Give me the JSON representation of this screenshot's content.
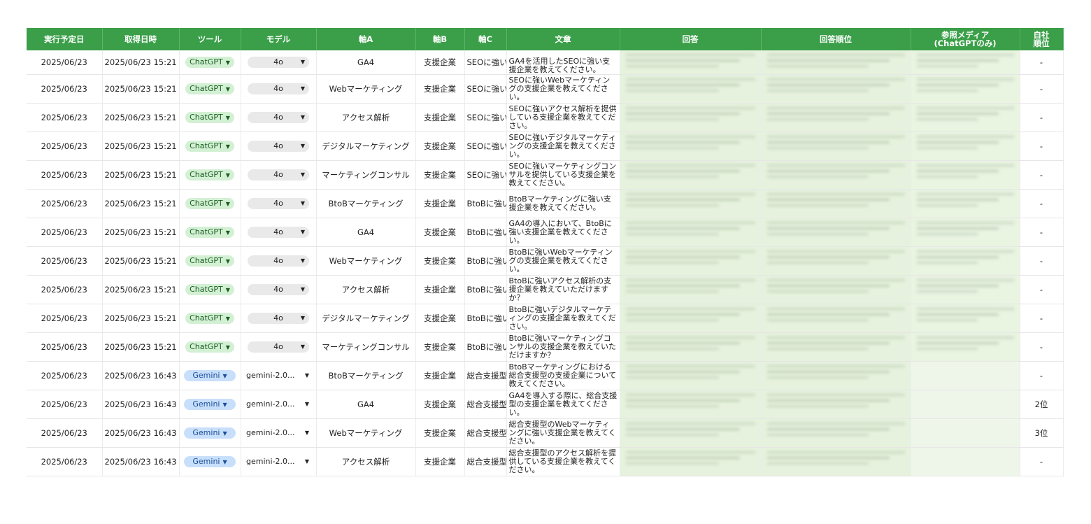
{
  "headers": [
    "実行予定日",
    "取得日時",
    "ツール",
    "モデル",
    "軸A",
    "軸B",
    "軸C",
    "文章",
    "回答",
    "回答順位",
    "参照メディア\n(ChatGPTのみ)",
    "自社\n順位"
  ],
  "rows": [
    {
      "date": "2025/06/23",
      "fetched": "2025/06/23 15:21",
      "tool": "ChatGPT",
      "model": "4o",
      "axisA": "GA4",
      "axisB": "支援企業",
      "axisC": "SEOに強い",
      "text": "GA4を活用したSEOに強い支援企業を教えてください。",
      "rank": "-"
    },
    {
      "date": "2025/06/23",
      "fetched": "2025/06/23 15:21",
      "tool": "ChatGPT",
      "model": "4o",
      "axisA": "Webマーケティング",
      "axisB": "支援企業",
      "axisC": "SEOに強い",
      "text": "SEOに強いWebマーケティングの支援企業を教えてください。",
      "rank": "-"
    },
    {
      "date": "2025/06/23",
      "fetched": "2025/06/23 15:21",
      "tool": "ChatGPT",
      "model": "4o",
      "axisA": "アクセス解析",
      "axisB": "支援企業",
      "axisC": "SEOに強い",
      "text": "SEOに強いアクセス解析を提供している支援企業を教えてください。",
      "rank": "-"
    },
    {
      "date": "2025/06/23",
      "fetched": "2025/06/23 15:21",
      "tool": "ChatGPT",
      "model": "4o",
      "axisA": "デジタルマーケティング",
      "axisB": "支援企業",
      "axisC": "SEOに強い",
      "text": "SEOに強いデジタルマーケティングの支援企業を教えてください。",
      "rank": "-"
    },
    {
      "date": "2025/06/23",
      "fetched": "2025/06/23 15:21",
      "tool": "ChatGPT",
      "model": "4o",
      "axisA": "マーケティングコンサル",
      "axisB": "支援企業",
      "axisC": "SEOに強い",
      "text": "SEOに強いマーケティングコンサルを提供している支援企業を教えてください。",
      "rank": "-"
    },
    {
      "date": "2025/06/23",
      "fetched": "2025/06/23 15:21",
      "tool": "ChatGPT",
      "model": "4o",
      "axisA": "BtoBマーケティング",
      "axisB": "支援企業",
      "axisC": "BtoBに強い",
      "text": "BtoBマーケティングに強い支援企業を教えてください。",
      "rank": "-"
    },
    {
      "date": "2025/06/23",
      "fetched": "2025/06/23 15:21",
      "tool": "ChatGPT",
      "model": "4o",
      "axisA": "GA4",
      "axisB": "支援企業",
      "axisC": "BtoBに強い",
      "text": "GA4の導入において、BtoBに強い支援企業を教えてください。",
      "rank": "-"
    },
    {
      "date": "2025/06/23",
      "fetched": "2025/06/23 15:21",
      "tool": "ChatGPT",
      "model": "4o",
      "axisA": "Webマーケティング",
      "axisB": "支援企業",
      "axisC": "BtoBに強い",
      "text": "BtoBに強いWebマーケティングの支援企業を教えてください。",
      "rank": "-"
    },
    {
      "date": "2025/06/23",
      "fetched": "2025/06/23 15:21",
      "tool": "ChatGPT",
      "model": "4o",
      "axisA": "アクセス解析",
      "axisB": "支援企業",
      "axisC": "BtoBに強い",
      "text": "BtoBに強いアクセス解析の支援企業を教えていただけますか？",
      "rank": "-"
    },
    {
      "date": "2025/06/23",
      "fetched": "2025/06/23 15:21",
      "tool": "ChatGPT",
      "model": "4o",
      "axisA": "デジタルマーケティング",
      "axisB": "支援企業",
      "axisC": "BtoBに強い",
      "text": "BtoBに強いデジタルマーケティングの支援企業を教えてください。",
      "rank": "-"
    },
    {
      "date": "2025/06/23",
      "fetched": "2025/06/23 15:21",
      "tool": "ChatGPT",
      "model": "4o",
      "axisA": "マーケティングコンサル",
      "axisB": "支援企業",
      "axisC": "BtoBに強い",
      "text": "BtoBに強いマーケティングコンサルの支援企業を教えていただけますか？",
      "rank": "-"
    },
    {
      "date": "2025/06/23",
      "fetched": "2025/06/23 16:43",
      "tool": "Gemini",
      "model": "gemini-2.0...",
      "axisA": "BtoBマーケティング",
      "axisB": "支援企業",
      "axisC": "総合支援型",
      "text": "BtoBマーケティングにおける総合支援型の支援企業について教えてください。",
      "rank": "-"
    },
    {
      "date": "2025/06/23",
      "fetched": "2025/06/23 16:43",
      "tool": "Gemini",
      "model": "gemini-2.0...",
      "axisA": "GA4",
      "axisB": "支援企業",
      "axisC": "総合支援型",
      "text": "GA4を導入する際に、総合支援型の支援企業を教えてください。",
      "rank": "2位"
    },
    {
      "date": "2025/06/23",
      "fetched": "2025/06/23 16:43",
      "tool": "Gemini",
      "model": "gemini-2.0...",
      "axisA": "Webマーケティング",
      "axisB": "支援企業",
      "axisC": "総合支援型",
      "text": "総合支援型のWebマーケティングに強い支援企業を教えてください。",
      "rank": "3位"
    },
    {
      "date": "2025/06/23",
      "fetched": "2025/06/23 16:43",
      "tool": "Gemini",
      "model": "gemini-2.0...",
      "axisA": "アクセス解析",
      "axisB": "支援企業",
      "axisC": "総合支援型",
      "text": "総合支援型のアクセス解析を提供している支援企業を教えてください。",
      "rank": "-"
    }
  ]
}
